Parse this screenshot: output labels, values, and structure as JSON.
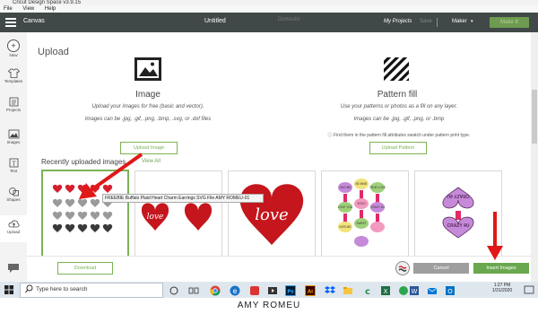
{
  "os_window": {
    "title": "Cricut Design Space v3.9.15",
    "menu": [
      "File",
      "View",
      "Help"
    ]
  },
  "header": {
    "app_name": "Canvas",
    "document_name": "Untitled",
    "ghost_label": "Domestic",
    "my_projects": "My Projects",
    "save": "Save",
    "machine": "Maker",
    "make_it": "Make It"
  },
  "sidebar": {
    "items": [
      {
        "label": "New",
        "icon": "plus-icon"
      },
      {
        "label": "Templates",
        "icon": "shirt-icon"
      },
      {
        "label": "Projects",
        "icon": "projects-icon"
      },
      {
        "label": "Images",
        "icon": "images-icon"
      },
      {
        "label": "Text",
        "icon": "text-icon"
      },
      {
        "label": "Shapes",
        "icon": "shapes-icon"
      },
      {
        "label": "Upload",
        "icon": "upload-icon"
      }
    ],
    "chat_icon": "chat-bubble-icon"
  },
  "upload_page": {
    "title": "Upload",
    "image": {
      "title": "Image",
      "description": "Upload your images for free (basic and vector).",
      "types": "Images can be .jpg, .gif, .png, .bmp, .svg, or .dxf files",
      "button": "Upload Image"
    },
    "pattern": {
      "title": "Pattern fill",
      "description": "Use your patterns or photos as a fill on any layer.",
      "types": "Images can be .jpg, .gif, .png, or .bmp",
      "note": "Find them in the pattern fill attributes swatch under pattern print type.",
      "button": "Upload Pattern"
    },
    "recent": {
      "title": "Recently uploaded images",
      "view_all": "View All",
      "tooltip": "FREEBIE Buffalo Plaid Heart Charm Earrings SVG File AMY ROMEU-01",
      "thumbnail_love_text": "love",
      "candy_texts": [
        "HUG ME",
        "BE MINE",
        "TRUE LOVE",
        "LOVE YOU",
        "XOXO",
        "CRAZY 4U",
        "KISS ME",
        "SWEET"
      ],
      "charm_texts": [
        "CRAZY 4U",
        "CRAZY 4U"
      ]
    },
    "buttons": {
      "download": "Download",
      "cancel": "Cancel",
      "insert": "Insert Images"
    }
  },
  "taskbar": {
    "search_placeholder": "Type here to search",
    "time": "1:27 PM",
    "date": "1/31/2020",
    "apps": [
      "task-view-icon",
      "chrome-icon",
      "edge-icon",
      "photos-icon",
      "media-icon",
      "photoshop-icon",
      "illustrator-icon",
      "dropbox-icon",
      "explorer-icon",
      "cricut-icon",
      "excel-icon",
      "sync-icon",
      "word-icon",
      "mail-icon",
      "outlook-icon"
    ]
  },
  "colors": {
    "header_bg": "#414848",
    "accent_green": "#6aa84f",
    "arrow_red": "#e01818"
  },
  "caption": "AMY ROMEU"
}
